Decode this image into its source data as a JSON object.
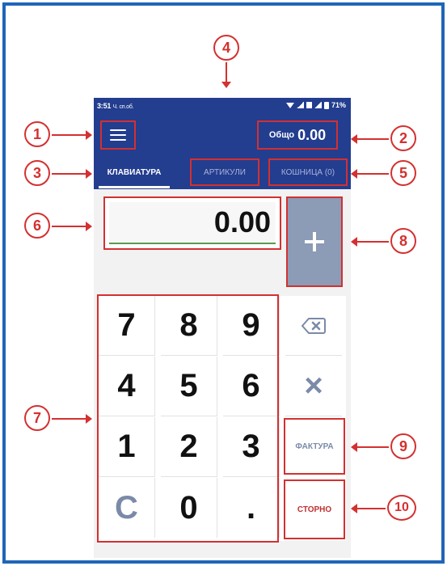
{
  "status": {
    "time": "3:51",
    "carrier": "Ч. сп.об.",
    "battery": "71%"
  },
  "header": {
    "total_label": "Общо",
    "total_value": "0.00"
  },
  "tabs": {
    "keyboard": "КЛАВИАТУРА",
    "articles": "АРТИКУЛИ",
    "cart": "КОШНИЦА (0)"
  },
  "amount": "0.00",
  "keypad": {
    "row1": [
      "7",
      "8",
      "9"
    ],
    "row2": [
      "4",
      "5",
      "6"
    ],
    "row3": [
      "1",
      "2",
      "3"
    ],
    "row4": [
      "C",
      "0",
      "."
    ],
    "multiply": "×",
    "invoice": "ФАКТУРА",
    "void": "СТОРНО"
  },
  "callouts": [
    "1",
    "2",
    "3",
    "4",
    "5",
    "6",
    "7",
    "8",
    "9",
    "10"
  ],
  "icons": {
    "menu": "hamburger-icon",
    "backspace": "backspace-icon",
    "add": "plus-icon"
  },
  "colors": {
    "appbar": "#233d8f",
    "callout": "#d43030",
    "frame": "#1f66b7"
  }
}
